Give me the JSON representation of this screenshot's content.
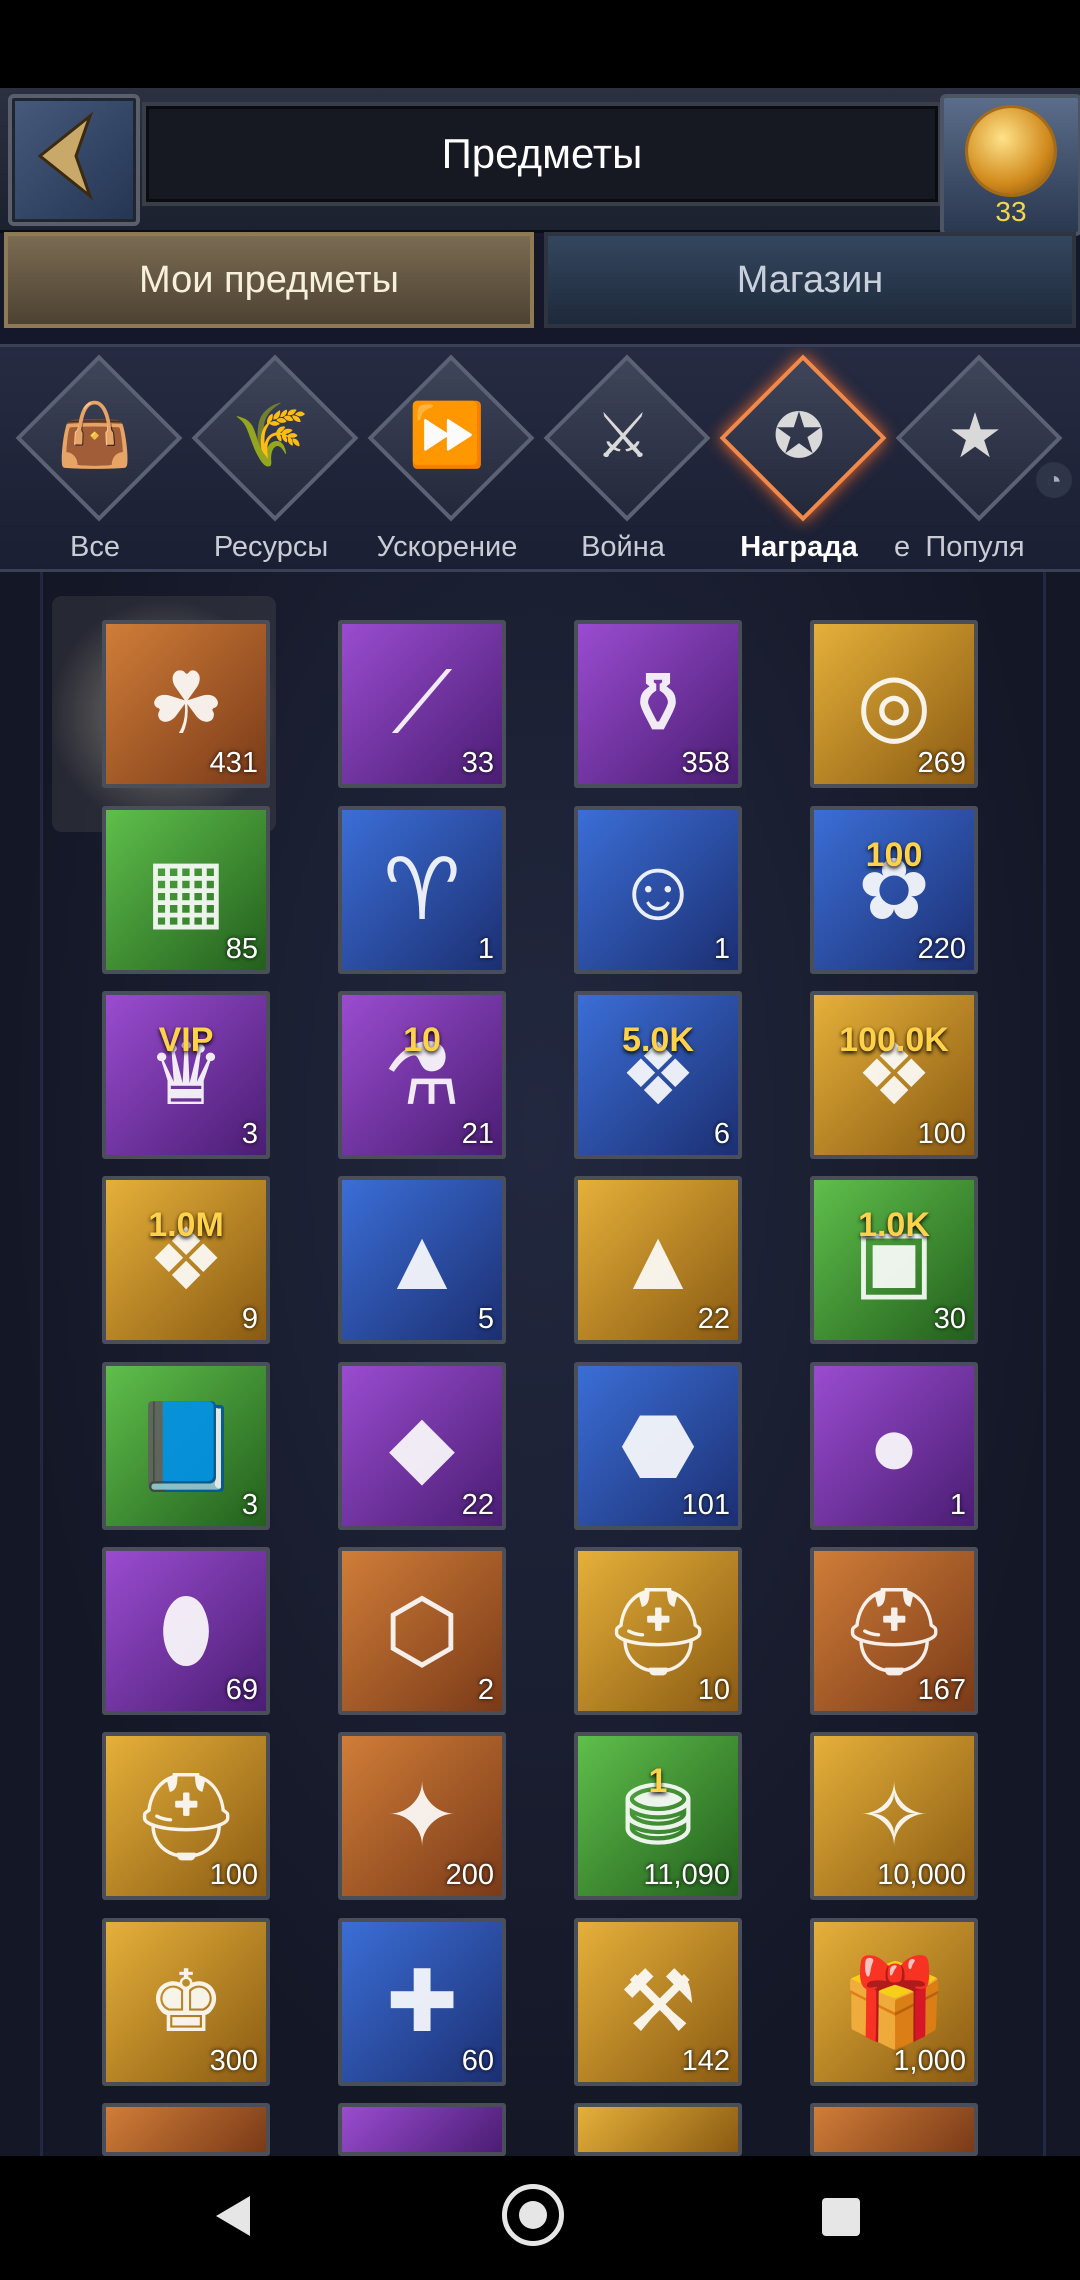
{
  "header": {
    "title": "Предметы",
    "coin_count": "33"
  },
  "tabs": {
    "my_items": "Мои предметы",
    "shop": "Магазин"
  },
  "categories": [
    {
      "label": "Все",
      "icon": "bag-icon",
      "glyph": "👜"
    },
    {
      "label": "Ресурсы",
      "icon": "wheat-icon",
      "glyph": "🌾"
    },
    {
      "label": "Ускорение",
      "icon": "fast-forward-icon",
      "glyph": "⏩"
    },
    {
      "label": "Война",
      "icon": "crossed-swords-icon",
      "glyph": "⚔"
    },
    {
      "label": "Награда",
      "icon": "medal-icon",
      "glyph": "✪",
      "active": true
    },
    {
      "label": "Популя",
      "icon": "star-icon",
      "glyph": "★"
    }
  ],
  "partial_label_e": "е",
  "items": [
    {
      "name": "clover",
      "bg": "orange",
      "glyph": "☘",
      "count": "431"
    },
    {
      "name": "spear",
      "bg": "purple",
      "glyph": "⟋",
      "count": "33"
    },
    {
      "name": "golden-vase",
      "bg": "purple",
      "glyph": "⚱",
      "count": "358"
    },
    {
      "name": "golden-ring",
      "bg": "gold",
      "glyph": "◎",
      "count": "269"
    },
    {
      "name": "resource-crate",
      "bg": "green",
      "glyph": "▦",
      "count": "85"
    },
    {
      "name": "war-horn",
      "bg": "blue",
      "glyph": "♈",
      "count": "1"
    },
    {
      "name": "heroes-swap",
      "bg": "blue",
      "glyph": "☺",
      "count": "1"
    },
    {
      "name": "badge-100",
      "bg": "blue",
      "glyph": "✿",
      "count": "220",
      "badge": "100"
    },
    {
      "name": "vip-badge",
      "bg": "purple",
      "glyph": "♛",
      "count": "3",
      "badge": "VIP"
    },
    {
      "name": "stamina-potion",
      "bg": "purple",
      "glyph": "⚗",
      "count": "21",
      "badge": "10"
    },
    {
      "name": "exp-5k",
      "bg": "blue",
      "glyph": "❖",
      "count": "6",
      "badge": "5.0K"
    },
    {
      "name": "exp-100k",
      "bg": "gold",
      "glyph": "❖",
      "count": "100",
      "badge": "100.0K"
    },
    {
      "name": "exp-1m",
      "bg": "gold",
      "glyph": "❖",
      "count": "9",
      "badge": "1.0M"
    },
    {
      "name": "silver-pyramid",
      "bg": "blue",
      "glyph": "▲",
      "count": "5"
    },
    {
      "name": "gold-pyramid",
      "bg": "gold",
      "glyph": "▲",
      "count": "22"
    },
    {
      "name": "chest-1k",
      "bg": "green",
      "glyph": "▣",
      "count": "30",
      "badge": "1.0K"
    },
    {
      "name": "book",
      "bg": "green",
      "glyph": "📘",
      "count": "3"
    },
    {
      "name": "crystal",
      "bg": "purple",
      "glyph": "◆",
      "count": "22"
    },
    {
      "name": "ore",
      "bg": "blue",
      "glyph": "⬣",
      "count": "101"
    },
    {
      "name": "orb",
      "bg": "purple",
      "glyph": "●",
      "count": "1"
    },
    {
      "name": "amethyst",
      "bg": "purple",
      "glyph": "⬮",
      "count": "69"
    },
    {
      "name": "clash-medal",
      "bg": "orange",
      "glyph": "⬡",
      "count": "2"
    },
    {
      "name": "helmet-card",
      "bg": "gold",
      "glyph": "⛑",
      "count": "10"
    },
    {
      "name": "spartan-card",
      "bg": "orange",
      "glyph": "⛑",
      "count": "167"
    },
    {
      "name": "spartan-card-gold",
      "bg": "gold",
      "glyph": "⛑",
      "count": "100"
    },
    {
      "name": "hero-puzzle",
      "bg": "orange",
      "glyph": "✦",
      "count": "200"
    },
    {
      "name": "gold-coins",
      "bg": "green",
      "glyph": "⛃",
      "count": "11,090",
      "badge": "1"
    },
    {
      "name": "gold-shard",
      "bg": "gold",
      "glyph": "✧",
      "count": "10,000"
    },
    {
      "name": "king-crest",
      "bg": "gold",
      "glyph": "♚",
      "count": "300"
    },
    {
      "name": "puzzle-piece",
      "bg": "blue",
      "glyph": "✚",
      "count": "60"
    },
    {
      "name": "resource-chests",
      "bg": "gold",
      "glyph": "⚒",
      "count": "142"
    },
    {
      "name": "treasure-chest",
      "bg": "gold",
      "glyph": "🎁",
      "count": "1,000"
    },
    {
      "name": "partial-1",
      "bg": "orange",
      "glyph": "",
      "count": ""
    },
    {
      "name": "partial-2",
      "bg": "purple",
      "glyph": "",
      "count": ""
    },
    {
      "name": "partial-3",
      "bg": "gold",
      "glyph": "",
      "count": ""
    },
    {
      "name": "partial-4",
      "bg": "orange",
      "glyph": "",
      "count": ""
    }
  ]
}
